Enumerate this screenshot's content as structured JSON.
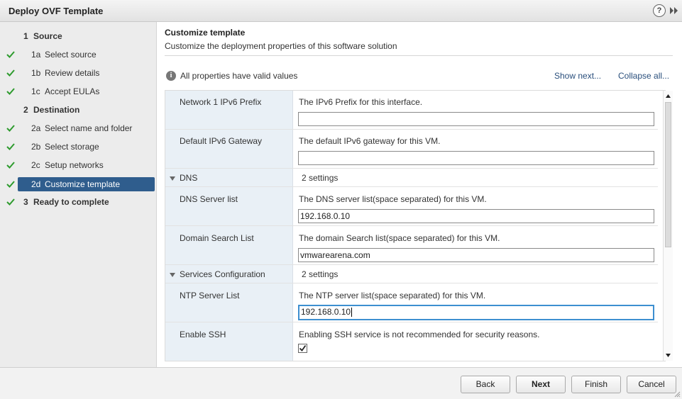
{
  "window": {
    "title": "Deploy OVF Template",
    "help_icon": "?"
  },
  "sidebar": {
    "items": [
      {
        "num": "1",
        "label": "Source",
        "type": "step",
        "done": false
      },
      {
        "num": "1a",
        "label": "Select source",
        "type": "sub",
        "done": true
      },
      {
        "num": "1b",
        "label": "Review details",
        "type": "sub",
        "done": true
      },
      {
        "num": "1c",
        "label": "Accept EULAs",
        "type": "sub",
        "done": true
      },
      {
        "num": "2",
        "label": "Destination",
        "type": "step",
        "done": false
      },
      {
        "num": "2a",
        "label": "Select name and folder",
        "type": "sub",
        "done": true
      },
      {
        "num": "2b",
        "label": "Select storage",
        "type": "sub",
        "done": true
      },
      {
        "num": "2c",
        "label": "Setup networks",
        "type": "sub",
        "done": true
      },
      {
        "num": "2d",
        "label": "Customize template",
        "type": "sub",
        "done": true,
        "selected": true
      },
      {
        "num": "3",
        "label": "Ready to complete",
        "type": "step",
        "done": true
      }
    ]
  },
  "main": {
    "title": "Customize template",
    "subtitle": "Customize the deployment properties of this software solution",
    "status": "All properties have valid values",
    "show_next": "Show next...",
    "collapse_all": "Collapse all...",
    "rows": [
      {
        "key": "Network 1 IPv6 Prefix",
        "desc": "The IPv6 Prefix for this interface.",
        "value": ""
      },
      {
        "key": "Default IPv6 Gateway",
        "desc": "The default IPv6 gateway for this VM.",
        "value": ""
      },
      {
        "group": "DNS",
        "settings": "2 settings"
      },
      {
        "key": "DNS Server list",
        "desc": "The DNS server list(space separated) for this VM.",
        "value": "192.168.0.10"
      },
      {
        "key": "Domain Search List",
        "desc": "The domain Search list(space separated) for this VM.",
        "value": "vmwarearena.com"
      },
      {
        "group": "Services Configuration",
        "settings": "2 settings"
      },
      {
        "key": "NTP Server List",
        "desc": "The NTP server list(space separated) for this VM.",
        "value": "192.168.0.10"
      },
      {
        "key": "Enable SSH",
        "desc": "Enabling SSH service is not recommended for security reasons.",
        "checked": true
      }
    ]
  },
  "footer": {
    "back": "Back",
    "next": "Next",
    "finish": "Finish",
    "cancel": "Cancel"
  },
  "colors": {
    "selected_bg": "#2f5d8d",
    "check_green": "#2e9b2e",
    "link": "#2a4f7c",
    "focus_border": "#3d8fd0"
  }
}
